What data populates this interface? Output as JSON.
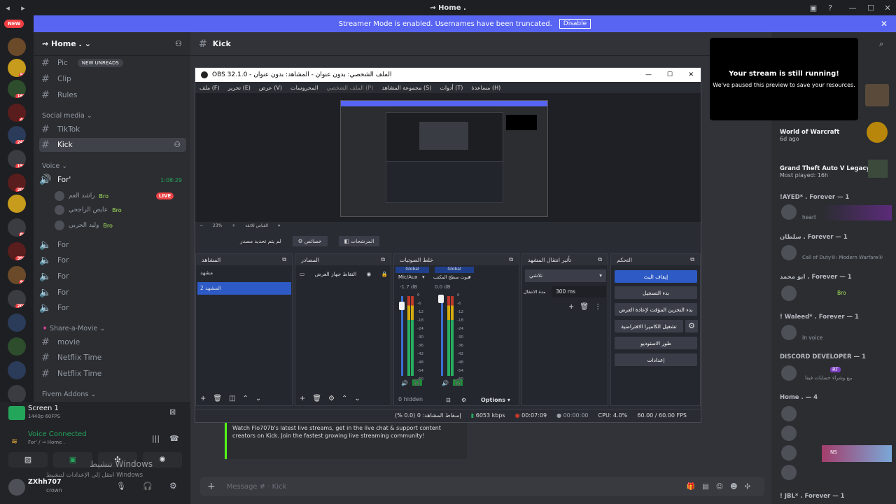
{
  "window": {
    "title": "⇝ Home ."
  },
  "banner": {
    "text": "Streamer Mode is enabled. Usernames have been truncated.",
    "disable": "Disable"
  },
  "servers": {
    "new_badge": "NEW",
    "badges": [
      "50",
      "163",
      "44",
      "247",
      "154",
      "207",
      "80",
      "393",
      "96",
      "202"
    ]
  },
  "guild": {
    "name": "⇝ Home ."
  },
  "channels": {
    "text": [
      "Pic",
      "Clip",
      "Rules"
    ],
    "new_unreads": "NEW UNREADS",
    "social_cat": "Social media",
    "social": [
      "TikTok",
      "Kick"
    ],
    "voice_cat": "Voice",
    "voice_main": "For'",
    "voice_timer": "1:08:29",
    "voice_users": [
      "راشد العم",
      "عايض الراجحي",
      "وليد الحربي"
    ],
    "bro": "Bro",
    "live": "LIVE",
    "voice_more": [
      "For",
      "For",
      "For",
      "For",
      "For"
    ],
    "share_cat": "Share-a-Movie",
    "share": [
      "movie",
      "Netflix Time",
      "Netflix Time"
    ],
    "fivem_cat": "Fivem Addons"
  },
  "user_panel": {
    "screen_title": "Screen 1",
    "screen_sub": "1440p 60FPS",
    "voice_connected": "Voice Connected",
    "voice_sub": "For' / ⇝ Home .",
    "username": "ZXhh707",
    "status": "crown",
    "windows_line1": "تنشيط Windows",
    "windows_line2": "انتقل إلى الإعدادات لتنشيط Windows"
  },
  "main": {
    "channel": "Kick",
    "embed": "Watch Flo707b's latest live streams, get in the live chat & support content creators on Kick. Join the fastest growing live streaming community!",
    "message_placeholder": "Message #  ·  Kick"
  },
  "obs": {
    "title": "OBS 32.1.0 - الملف الشخصي: بدون عنوان - المشاهد: بدون عنوان",
    "menu": [
      "ملف (F)",
      "تحرير (E)",
      "عرض (V)",
      "المحروسات",
      "الملف الشخصي (P)",
      "مجموعة المشاهد (S)",
      "أدوات (T)",
      "مساعدة (H)"
    ],
    "zoom": "23%",
    "preview_label": "القياس للائقة",
    "no_source": "لم يتم تحديد مصدر",
    "props": "خصائص",
    "filters": "المرشحات",
    "docks": {
      "scenes": "المشاهد",
      "sources": "المصادر",
      "mixer": "خلط الصوتيات",
      "transitions": "تأثير انتقال المشهد",
      "controls": "التحكم"
    },
    "scenes": [
      "مشهد",
      "المشهد 2"
    ],
    "source_item": "التقاط جهاز العرض",
    "mixer": {
      "global": "Global",
      "ch1": "Mic/Aux",
      "ch1_db": "-1.7 dB",
      "ch2": "صوت سطح المكتب",
      "ch2_db": "0.0 dB",
      "scale": [
        "0",
        "-6",
        "-12",
        "-18",
        "-24",
        "-30",
        "-36",
        "-42",
        "-48",
        "-54",
        "-60"
      ],
      "hidden": "0 hidden",
      "options": "Options"
    },
    "transitions": {
      "type": "تلاشي",
      "duration_label": "مدة الانتقال",
      "duration": "300 ms"
    },
    "controls": [
      "إيقاف البث",
      "بدء التسجيل",
      "بدء التخزين المؤقت لإعادة العرض",
      "تشغيل الكاميرا الافتراضية",
      "طور الاستوديو",
      "إعدادات"
    ],
    "status": {
      "dropped": "إسقاط المشاهد: 0 (0.0 %)",
      "bitrate": "6053 kbps",
      "live_time": "00:07:09",
      "rec_time": "00:00:00",
      "cpu": "CPU: 4.0%",
      "fps": "60.00 / 60.00 FPS"
    }
  },
  "toast": {
    "title": "Your stream is still running!",
    "sub": "We've paused this preview to save your resources."
  },
  "activity": {
    "games": [
      {
        "name": "World of Warcraft",
        "sub": "6d ago"
      },
      {
        "name": "Grand Theft Auto V Legacy",
        "sub": "Most played: 16h"
      }
    ],
    "groups": [
      {
        "head": "!AYED* . Forever — 1",
        "sub": "heart"
      },
      {
        "head": "سلطان . Forever — 1",
        "sub": "Call of Duty®: Modern Warfare®"
      },
      {
        "head": "ابو محمد . Forever — 1",
        "sub": "Bro"
      },
      {
        "head": "! Waleed* . Forever — 1",
        "sub": "In voice"
      }
    ],
    "dev_head": "DISCORD DEVELOPER — 1",
    "dev_tag": "RT",
    "dev_sub": "بيع وشراء حسابات فيفا",
    "home_head": "Home . — 4",
    "home_tag": "NS",
    "last_head": "! JBL* . Forever — 1"
  }
}
